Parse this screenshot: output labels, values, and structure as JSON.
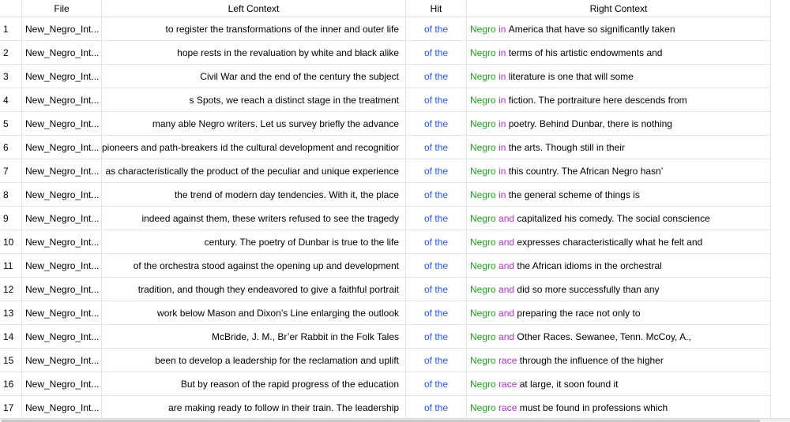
{
  "columns": {
    "num": "",
    "file": "File",
    "left": "Left Context",
    "hit": "Hit",
    "right": "Right Context"
  },
  "rows": [
    {
      "num": "1",
      "file": "New_Negro_Int...",
      "left": "to register the transformations of the inner and outer life",
      "hit": "of the",
      "kw1": "Negro",
      "kw2": "in",
      "right": "America that have so significantly taken"
    },
    {
      "num": "2",
      "file": "New_Negro_Int...",
      "left": "hope rests in the revaluation by white and black alike",
      "hit": "of the",
      "kw1": "Negro",
      "kw2": "in",
      "right": "terms of his artistic endowments and"
    },
    {
      "num": "3",
      "file": "New_Negro_Int...",
      "left": "Civil War and the end of the century the subject",
      "hit": "of the",
      "kw1": "Negro",
      "kw2": "in",
      "right": "literature is one that will some"
    },
    {
      "num": "4",
      "file": "New_Negro_Int...",
      "left": "s Spots, we reach a distinct stage in the treatment",
      "hit": "of the",
      "kw1": "Negro",
      "kw2": "in",
      "right": "fiction. The portraiture here descends from"
    },
    {
      "num": "5",
      "file": "New_Negro_Int...",
      "left": "many able Negro writers. Let us survey briefly the advance",
      "hit": "of the",
      "kw1": "Negro",
      "kw2": "in",
      "right": "poetry. Behind Dunbar, there is nothing"
    },
    {
      "num": "6",
      "file": "New_Negro_Int...",
      "left": "pioneers and path-breakers id the cultural development and recognition",
      "hit": "of the",
      "kw1": "Negro",
      "kw2": "in",
      "right": "the arts. Though still in their"
    },
    {
      "num": "7",
      "file": "New_Negro_Int...",
      "left": "as characteristically the product of the peculiar and unique experience",
      "hit": "of the",
      "kw1": "Negro",
      "kw2": "in",
      "right": "this country. The African Negro hasn’"
    },
    {
      "num": "8",
      "file": "New_Negro_Int...",
      "left": "the trend of modern day tendencies. With it, the place",
      "hit": "of the",
      "kw1": "Negro",
      "kw2": "in",
      "right": "the general scheme of things is"
    },
    {
      "num": "9",
      "file": "New_Negro_Int...",
      "left": "indeed against them, these writers refused to see the tragedy",
      "hit": "of the",
      "kw1": "Negro",
      "kw2": "and",
      "right": "capitalized his comedy. The social conscience"
    },
    {
      "num": "10",
      "file": "New_Negro_Int...",
      "left": "century. The poetry of Dunbar is true to the life",
      "hit": "of the",
      "kw1": "Negro",
      "kw2": "and",
      "right": "expresses characteristically what he felt and"
    },
    {
      "num": "11",
      "file": "New_Negro_Int...",
      "left": "of the orchestra stood against the opening up and development",
      "hit": "of the",
      "kw1": "Negro",
      "kw2": "and",
      "right": "the African idioms in the orchestral"
    },
    {
      "num": "12",
      "file": "New_Negro_Int...",
      "left": "tradition, and though they endeavored to give a faithful portrait",
      "hit": "of the",
      "kw1": "Negro",
      "kw2": "and",
      "right": "did so more successfully than any"
    },
    {
      "num": "13",
      "file": "New_Negro_Int...",
      "left": "work below Mason and Dixon’s Line enlarging the outlook",
      "hit": "of the",
      "kw1": "Negro",
      "kw2": "and",
      "right": "preparing the race not only to"
    },
    {
      "num": "14",
      "file": "New_Negro_Int...",
      "left": "McBride, J. M., Br’er Rabbit in the Folk Tales",
      "hit": "of the",
      "kw1": "Negro",
      "kw2": "and",
      "right": "Other Races. Sewanee, Tenn. McCoy, A.,"
    },
    {
      "num": "15",
      "file": "New_Negro_Int...",
      "left": "been to develop a leadership for the reclamation and uplift",
      "hit": "of the",
      "kw1": "Negro",
      "kw2": "race",
      "right": "through the influence of the higher"
    },
    {
      "num": "16",
      "file": "New_Negro_Int...",
      "left": "But by reason of the rapid progress of the education",
      "hit": "of the",
      "kw1": "Negro",
      "kw2": "race",
      "right": "at large, it soon found it"
    },
    {
      "num": "17",
      "file": "New_Negro_Int...",
      "left": "are making ready to follow in their train. The leadership",
      "hit": "of the",
      "kw1": "Negro",
      "kw2": "race",
      "right": "must be found in professions which"
    }
  ],
  "colors": {
    "hit": "#2255ff",
    "kw1": "#1aa31a",
    "kw2": "#b02fd0",
    "grid_line": "#e4e4e4"
  }
}
